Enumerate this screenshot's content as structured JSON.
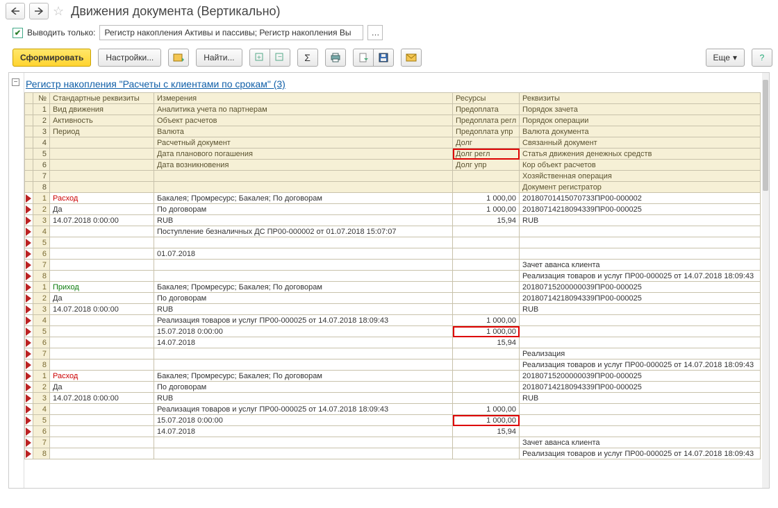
{
  "header": {
    "title": "Движения документа (Вертикально)"
  },
  "filter": {
    "checkbox_checked": true,
    "label": "Выводить только:",
    "value": "Регистр накопления Активы и пассивы; Регистр накопления Вы"
  },
  "toolbar": {
    "generate": "Сформировать",
    "settings": "Настройки...",
    "find": "Найти...",
    "more": "Еще"
  },
  "report": {
    "section_title": "Регистр накопления \"Расчеты с клиентами по срокам\" (3)",
    "columns": {
      "no": "№",
      "std": "Стандартные реквизиты",
      "dim": "Измерения",
      "res": "Ресурсы",
      "req": "Реквизиты"
    },
    "header_rows": [
      {
        "n": "1",
        "std": "Вид движения",
        "dim": "Аналитика учета по партнерам",
        "res": "Предоплата",
        "req": "Порядок зачета"
      },
      {
        "n": "2",
        "std": "Активность",
        "dim": "Объект расчетов",
        "res": "Предоплата регл",
        "req": "Порядок операции"
      },
      {
        "n": "3",
        "std": "Период",
        "dim": "Валюта",
        "res": "Предоплата упр",
        "req": "Валюта документа"
      },
      {
        "n": "4",
        "std": "",
        "dim": "Расчетный документ",
        "res": "Долг",
        "req": "Связанный документ"
      },
      {
        "n": "5",
        "std": "",
        "dim": "Дата планового погашения",
        "res": "Долг регл",
        "req": "Статья движения денежных средств",
        "res_hl": true
      },
      {
        "n": "6",
        "std": "",
        "dim": "Дата возникновения",
        "res": "Долг упр",
        "req": "Кор объект расчетов"
      },
      {
        "n": "7",
        "std": "",
        "dim": "",
        "res": "",
        "req": "Хозяйственная операция"
      },
      {
        "n": "8",
        "std": "",
        "dim": "",
        "res": "",
        "req": "Документ регистратор"
      }
    ],
    "blocks": [
      {
        "rows": [
          {
            "n": "1",
            "marker": true,
            "std": "Расход",
            "std_cls": "txt-red",
            "dim": "Бакалея; Промресурс; Бакалея; По договорам",
            "res": "1 000,00",
            "req": "20180701415070733ПР00-000002"
          },
          {
            "n": "2",
            "marker": true,
            "std": "Да",
            "dim": "По договорам",
            "res": "1 000,00",
            "req": "20180714218094339ПР00-000025"
          },
          {
            "n": "3",
            "marker": true,
            "std": "14.07.2018 0:00:00",
            "dim": "RUB",
            "res": "15,94",
            "req": "RUB"
          },
          {
            "n": "4",
            "marker": true,
            "std": "",
            "dim": "Поступление безналичных ДС ПР00-000002 от 01.07.2018 15:07:07",
            "res": "",
            "req": ""
          },
          {
            "n": "5",
            "marker": true,
            "std": "",
            "dim": "",
            "res": "",
            "req": ""
          },
          {
            "n": "6",
            "marker": true,
            "std": "",
            "dim": "01.07.2018",
            "res": "",
            "req": ""
          },
          {
            "n": "7",
            "marker": true,
            "std": "",
            "dim": "",
            "res": "",
            "req": "Зачет аванса клиента"
          },
          {
            "n": "8",
            "marker": true,
            "std": "",
            "dim": "",
            "res": "",
            "req": "Реализация товаров и услуг ПР00-000025 от 14.07.2018 18:09:43"
          }
        ]
      },
      {
        "rows": [
          {
            "n": "1",
            "marker": true,
            "std": "Приход",
            "std_cls": "txt-green",
            "dim": "Бакалея; Промресурс; Бакалея; По договорам",
            "res": "",
            "req": "20180715200000039ПР00-000025"
          },
          {
            "n": "2",
            "marker": true,
            "std": "Да",
            "dim": "По договорам",
            "res": "",
            "req": "20180714218094339ПР00-000025"
          },
          {
            "n": "3",
            "marker": true,
            "std": "14.07.2018 0:00:00",
            "dim": "RUB",
            "res": "",
            "req": "RUB"
          },
          {
            "n": "4",
            "marker": true,
            "std": "",
            "dim": "Реализация товаров и услуг ПР00-000025 от 14.07.2018 18:09:43",
            "res": "1 000,00",
            "req": ""
          },
          {
            "n": "5",
            "marker": true,
            "std": "",
            "dim": "15.07.2018 0:00:00",
            "res": "1 000,00",
            "req": "",
            "res_hl": true
          },
          {
            "n": "6",
            "marker": true,
            "std": "",
            "dim": "14.07.2018",
            "res": "15,94",
            "req": ""
          },
          {
            "n": "7",
            "marker": true,
            "std": "",
            "dim": "",
            "res": "",
            "req": "Реализация"
          },
          {
            "n": "8",
            "marker": true,
            "std": "",
            "dim": "",
            "res": "",
            "req": "Реализация товаров и услуг ПР00-000025 от 14.07.2018 18:09:43"
          }
        ]
      },
      {
        "rows": [
          {
            "n": "1",
            "marker": true,
            "std": "Расход",
            "std_cls": "txt-red",
            "dim": "Бакалея; Промресурс; Бакалея; По договорам",
            "res": "",
            "req": "20180715200000039ПР00-000025"
          },
          {
            "n": "2",
            "marker": true,
            "std": "Да",
            "dim": "По договорам",
            "res": "",
            "req": "20180714218094339ПР00-000025"
          },
          {
            "n": "3",
            "marker": true,
            "std": "14.07.2018 0:00:00",
            "dim": "RUB",
            "res": "",
            "req": "RUB"
          },
          {
            "n": "4",
            "marker": true,
            "std": "",
            "dim": "Реализация товаров и услуг ПР00-000025 от 14.07.2018 18:09:43",
            "res": "1 000,00",
            "req": ""
          },
          {
            "n": "5",
            "marker": true,
            "std": "",
            "dim": "15.07.2018 0:00:00",
            "res": "1 000,00",
            "req": "",
            "res_hl": true
          },
          {
            "n": "6",
            "marker": true,
            "std": "",
            "dim": "14.07.2018",
            "res": "15,94",
            "req": ""
          },
          {
            "n": "7",
            "marker": true,
            "std": "",
            "dim": "",
            "res": "",
            "req": "Зачет аванса клиента"
          },
          {
            "n": "8",
            "marker": true,
            "std": "",
            "dim": "",
            "res": "",
            "req": "Реализация товаров и услуг ПР00-000025 от 14.07.2018 18:09:43"
          }
        ]
      }
    ]
  }
}
